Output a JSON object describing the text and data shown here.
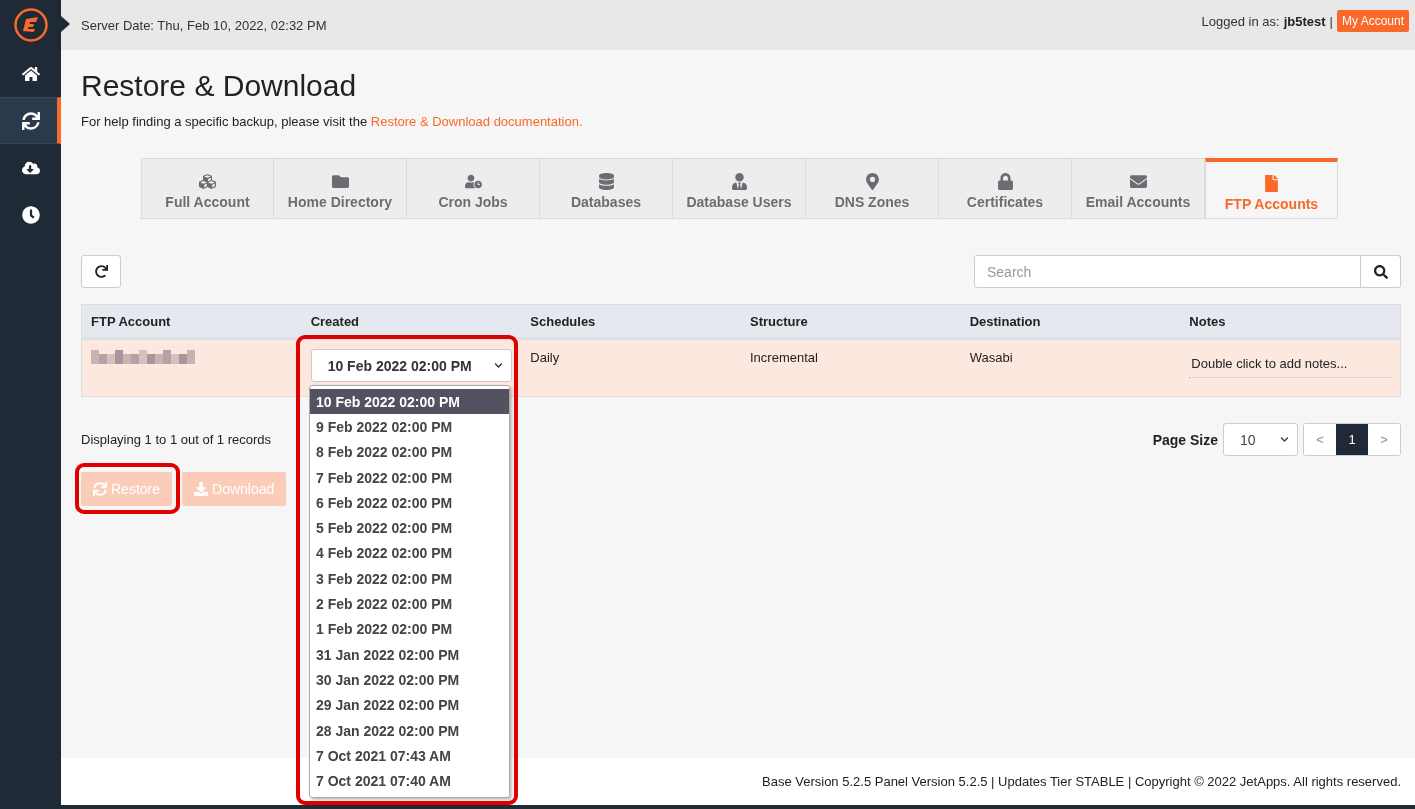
{
  "sidebar": {
    "items": [
      {
        "selected": false
      },
      {
        "selected": true
      },
      {
        "selected": false
      },
      {
        "selected": false
      }
    ]
  },
  "topbar": {
    "server_date": "Server Date: Thu, Feb 10, 2022, 02:32 PM",
    "logged_in_label": "Logged in as:",
    "username": "jb5test",
    "separator": "|",
    "account_button": "My Account"
  },
  "page": {
    "title": "Restore & Download",
    "help_text": "For help finding a specific backup, please visit the",
    "help_link": "Restore & Download documentation."
  },
  "tabs": [
    {
      "label": "Full Account",
      "selected": false
    },
    {
      "label": "Home Directory",
      "selected": false
    },
    {
      "label": "Cron Jobs",
      "selected": false
    },
    {
      "label": "Databases",
      "selected": false
    },
    {
      "label": "Database Users",
      "selected": false
    },
    {
      "label": "DNS Zones",
      "selected": false
    },
    {
      "label": "Certificates",
      "selected": false
    },
    {
      "label": "Email Accounts",
      "selected": false
    },
    {
      "label": "FTP Accounts",
      "selected": true
    }
  ],
  "search": {
    "placeholder": "Search"
  },
  "table": {
    "columns": [
      "FTP Account",
      "Created",
      "Schedules",
      "Structure",
      "Destination",
      "Notes"
    ],
    "rows": [
      {
        "created": "10 Feb 2022 02:00 PM",
        "schedules": "Daily",
        "structure": "Incremental",
        "destination": "Wasabi",
        "notes": "Double click to add notes...",
        "highlighted": true
      }
    ]
  },
  "created_dropdown": {
    "expanded": true,
    "highlighted": true,
    "options": [
      {
        "label": "10 Feb 2022 02:00 PM",
        "selected": true
      },
      {
        "label": "9 Feb 2022 02:00 PM",
        "selected": false
      },
      {
        "label": "8 Feb 2022 02:00 PM",
        "selected": false
      },
      {
        "label": "7 Feb 2022 02:00 PM",
        "selected": false
      },
      {
        "label": "6 Feb 2022 02:00 PM",
        "selected": false
      },
      {
        "label": "5 Feb 2022 02:00 PM",
        "selected": false
      },
      {
        "label": "4 Feb 2022 02:00 PM",
        "selected": false
      },
      {
        "label": "3 Feb 2022 02:00 PM",
        "selected": false
      },
      {
        "label": "2 Feb 2022 02:00 PM",
        "selected": false
      },
      {
        "label": "1 Feb 2022 02:00 PM",
        "selected": false
      },
      {
        "label": "31 Jan 2022 02:00 PM",
        "selected": false
      },
      {
        "label": "30 Jan 2022 02:00 PM",
        "selected": false
      },
      {
        "label": "29 Jan 2022 02:00 PM",
        "selected": false
      },
      {
        "label": "28 Jan 2022 02:00 PM",
        "selected": false
      },
      {
        "label": "7 Oct 2021 07:43 AM",
        "selected": false
      },
      {
        "label": "7 Oct 2021 07:40 AM",
        "selected": false
      }
    ]
  },
  "records_text": "Displaying 1 to 1 out of 1 records",
  "pagination": {
    "page_size_label": "Page Size",
    "page_size": "10",
    "prev": "<",
    "next": ">",
    "pages": [
      {
        "label": "1",
        "selected": true
      }
    ]
  },
  "actions": [
    {
      "label": "Restore",
      "disabled": true,
      "highlighted": true
    },
    {
      "label": "Download",
      "disabled": true,
      "highlighted": false
    }
  ],
  "footer": "Base Version 5.2.5 Panel Version 5.2.5 | Updates Tier STABLE | Copyright © 2022 JetApps. All rights reserved."
}
